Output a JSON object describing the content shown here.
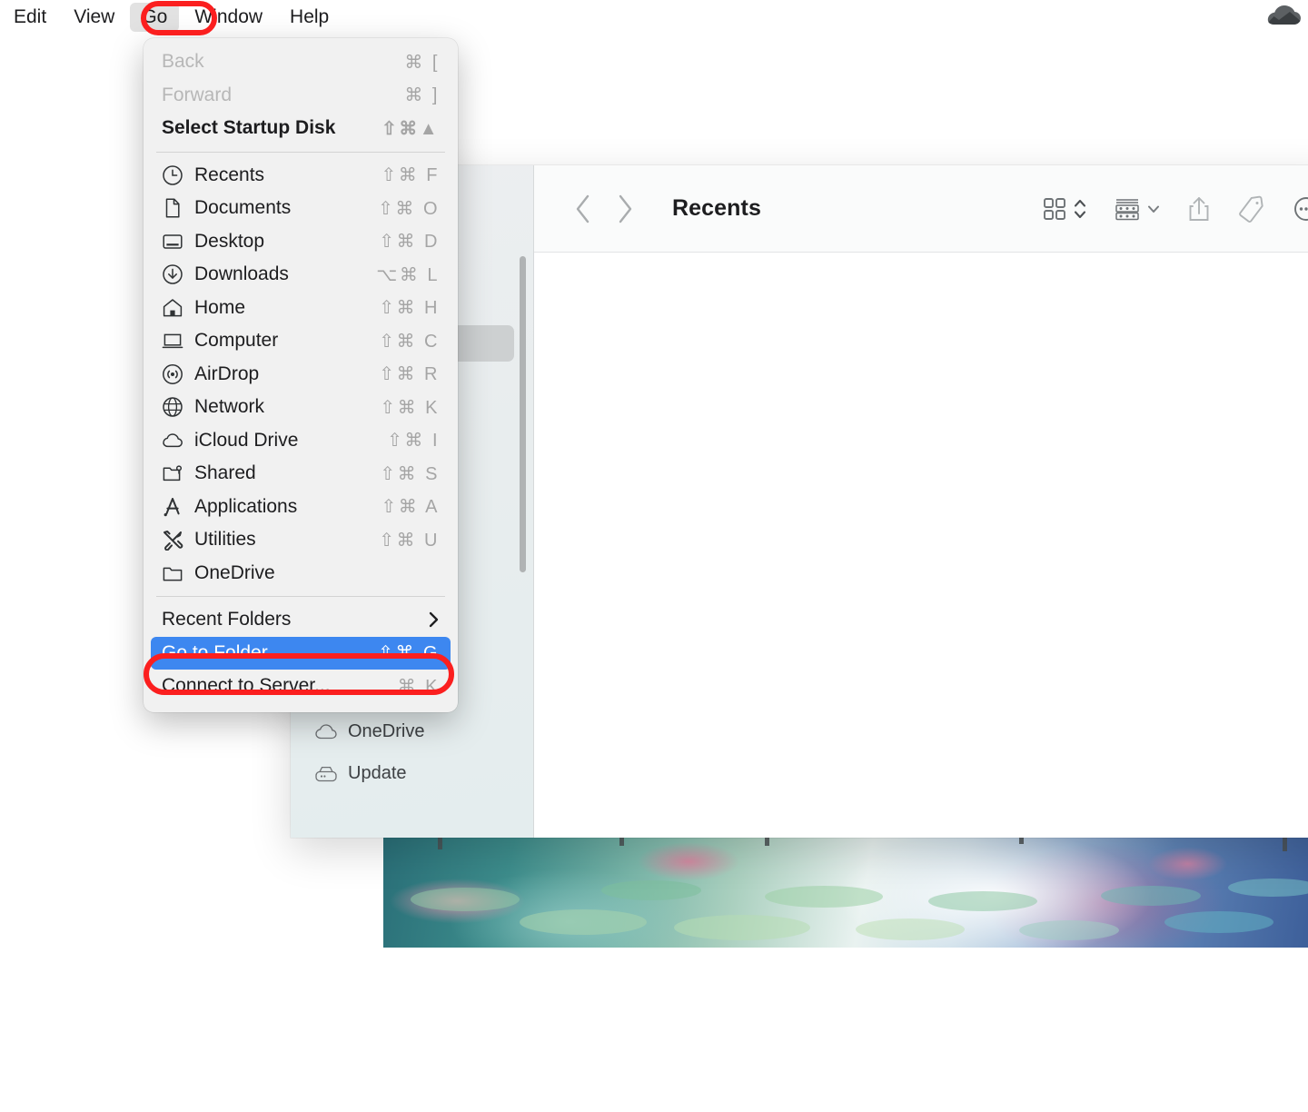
{
  "menubar": {
    "items": [
      {
        "label": "Edit",
        "active": false
      },
      {
        "label": "View",
        "active": false
      },
      {
        "label": "Go",
        "active": true
      },
      {
        "label": "Window",
        "active": false
      },
      {
        "label": "Help",
        "active": false
      }
    ],
    "status_icon": "cloud-icon"
  },
  "go_menu": {
    "groups": [
      {
        "items": [
          {
            "label": "Back",
            "shortcut": "⌘ [",
            "icon": null,
            "state": "disabled"
          },
          {
            "label": "Forward",
            "shortcut": "⌘ ]",
            "icon": null,
            "state": "disabled"
          },
          {
            "label": "Select Startup Disk",
            "shortcut": "⇧⌘▲",
            "icon": null,
            "state": "bold"
          }
        ]
      },
      {
        "items": [
          {
            "label": "Recents",
            "shortcut": "⇧⌘ F",
            "icon": "clock-icon",
            "state": "normal"
          },
          {
            "label": "Documents",
            "shortcut": "⇧⌘ O",
            "icon": "document-icon",
            "state": "normal"
          },
          {
            "label": "Desktop",
            "shortcut": "⇧⌘ D",
            "icon": "desktop-icon",
            "state": "normal"
          },
          {
            "label": "Downloads",
            "shortcut": "⌥⌘ L",
            "icon": "download-icon",
            "state": "normal"
          },
          {
            "label": "Home",
            "shortcut": "⇧⌘ H",
            "icon": "home-icon",
            "state": "normal"
          },
          {
            "label": "Computer",
            "shortcut": "⇧⌘ C",
            "icon": "computer-icon",
            "state": "normal"
          },
          {
            "label": "AirDrop",
            "shortcut": "⇧⌘ R",
            "icon": "airdrop-icon",
            "state": "normal"
          },
          {
            "label": "Network",
            "shortcut": "⇧⌘ K",
            "icon": "globe-icon",
            "state": "normal"
          },
          {
            "label": "iCloud Drive",
            "shortcut": "⇧⌘ I",
            "icon": "cloud-icon",
            "state": "normal"
          },
          {
            "label": "Shared",
            "shortcut": "⇧⌘ S",
            "icon": "shared-folder-icon",
            "state": "normal"
          },
          {
            "label": "Applications",
            "shortcut": "⇧⌘ A",
            "icon": "appstore-icon",
            "state": "normal"
          },
          {
            "label": "Utilities",
            "shortcut": "⇧⌘ U",
            "icon": "tools-icon",
            "state": "normal"
          },
          {
            "label": "OneDrive",
            "shortcut": "",
            "icon": "folder-icon",
            "state": "normal"
          }
        ]
      },
      {
        "items": [
          {
            "label": "Recent Folders",
            "shortcut": "",
            "icon": null,
            "state": "submenu"
          }
        ]
      },
      {
        "items": [
          {
            "label": "Go to Folder...",
            "shortcut": "⇧⌘ G",
            "icon": null,
            "state": "selected"
          },
          {
            "label": "Connect to Server...",
            "shortcut": "⌘ K",
            "icon": null,
            "state": "normal"
          }
        ]
      }
    ]
  },
  "finder": {
    "toolbar": {
      "back_icon": "chevron-left-icon",
      "forward_icon": "chevron-right-icon",
      "title": "Recents",
      "view_icon": "icon-view-icon",
      "view_stepper_icon": "updown-chevron-icon",
      "group_icon": "group-list-icon",
      "share_icon": "share-icon",
      "tag_icon": "tag-icon",
      "more_icon": "more-ellipsis-icon"
    },
    "sidebar": {
      "items": [
        {
          "label": "OneDrive",
          "icon": "cloud-icon"
        },
        {
          "label": "Update",
          "icon": "harddisk-icon"
        }
      ]
    }
  },
  "annotations": {
    "color": "#fb1f1f",
    "highlights": [
      {
        "target": "Go",
        "shape": "rounded-rect"
      },
      {
        "target": "Go to Folder...",
        "shape": "rounded-rect"
      }
    ]
  },
  "wallpaper": {
    "description": "watercolor lily pond"
  }
}
